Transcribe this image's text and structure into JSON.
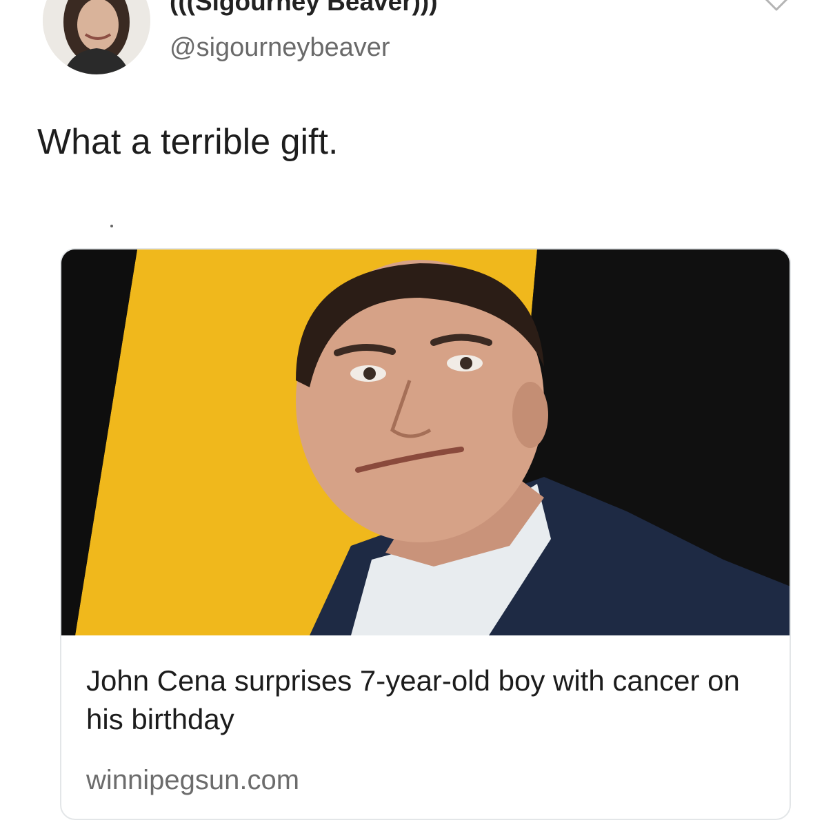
{
  "tweet": {
    "author": {
      "display_name": "(((Sigourney Beaver)))",
      "handle": "@sigourneybeaver",
      "avatar_icon": "avatar-photo"
    },
    "menu_icon": "chevron-down-icon",
    "text": "What a terrible gift.",
    "link_card": {
      "image_icon": "article-photo",
      "title": "John Cena surprises 7-year-old boy with cancer on his birthday",
      "domain": "winnipegsun.com"
    }
  },
  "colors": {
    "background": "#ffffff",
    "handle_gray": "#6a6a6a",
    "card_border": "#e3e6e8",
    "photo_yellow": "#f0b81c",
    "photo_black": "#111111",
    "suit_navy": "#1e2a44"
  }
}
